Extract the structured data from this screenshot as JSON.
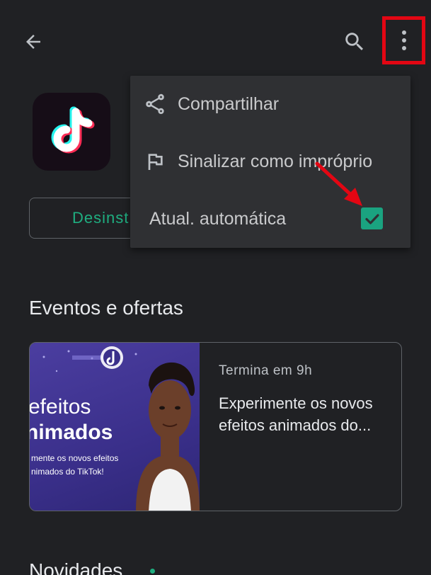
{
  "topbar": {
    "back_icon": "arrow-left-icon",
    "search_icon": "search-icon",
    "more_icon": "more-vert-icon",
    "highlight_color": "#e30613"
  },
  "app": {
    "icon": "tiktok-logo",
    "uninstall_label": "Desinst"
  },
  "menu": {
    "items": [
      {
        "label": "Compartilhar",
        "icon": "share-icon"
      },
      {
        "label": "Sinalizar como impróprio",
        "icon": "flag-icon"
      },
      {
        "label": "Atual. automática",
        "checked": true,
        "icon": "checkbox-checked-icon"
      }
    ],
    "annotation": "red-arrow-pointing-to-checkbox"
  },
  "events": {
    "section_title": "Eventos e ofertas",
    "card": {
      "image_text": {
        "line1": "efeitos",
        "line2": "nimados",
        "small1": "mente os novos efeitos",
        "small2": "nimados do TikTok!"
      },
      "meta": "Termina em 9h",
      "desc_line1": "Experimente os novos",
      "desc_line2": "efeitos animados do..."
    }
  },
  "novidades": {
    "title": "Novidades"
  },
  "colors": {
    "background": "#202124",
    "menu_bg": "#2f3033",
    "accent_green": "#1fae80",
    "checkbox": "#1aa380"
  }
}
